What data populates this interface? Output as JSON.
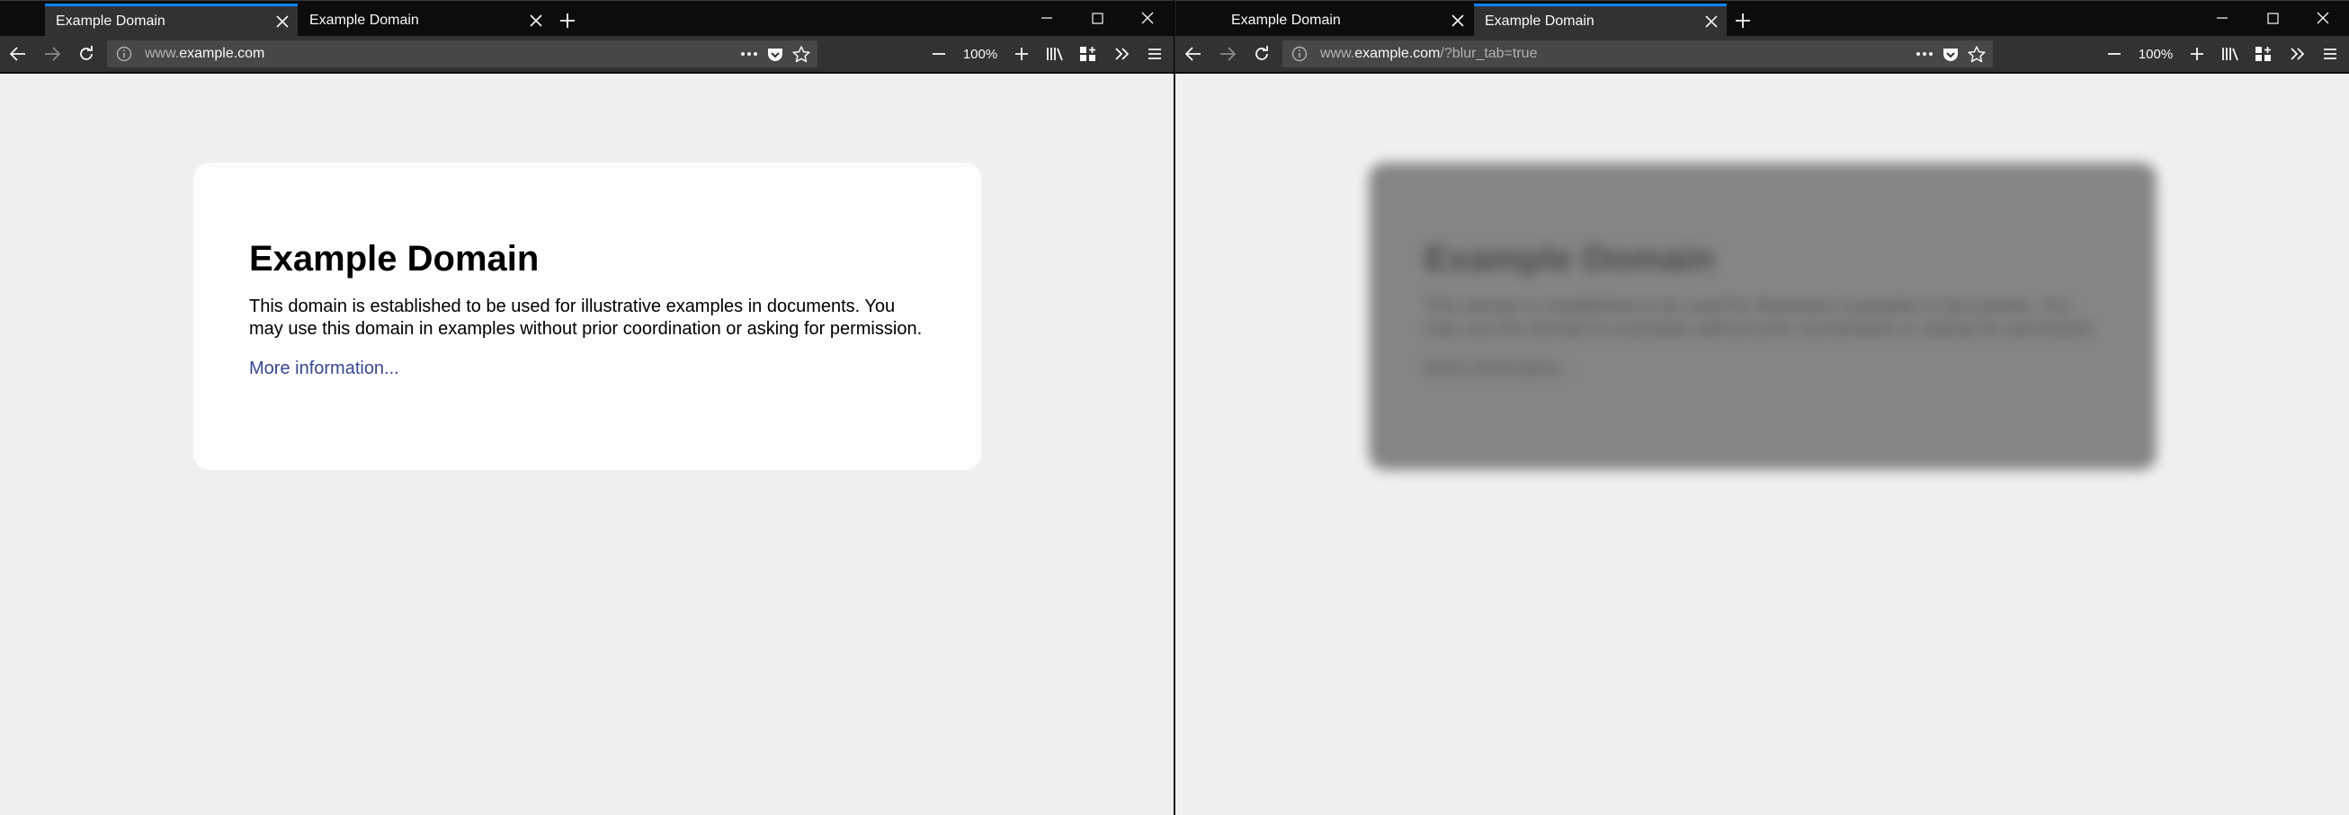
{
  "colors": {
    "chrome_dark": "#0c0c0d",
    "toolbar": "#323234",
    "urlbar": "#474749",
    "accent_tab": "#0a84ff",
    "page_bg": "#f0f0f2",
    "card_bg": "#fdfdff",
    "link": "#38488f"
  },
  "left": {
    "tabs": [
      {
        "title": "Example Domain",
        "active": true
      },
      {
        "title": "Example Domain",
        "active": false
      }
    ],
    "url": {
      "prefix": "www.",
      "domain": "example.com",
      "suffix": ""
    },
    "zoom": "100%",
    "page": {
      "heading": "Example Domain",
      "body": "This domain is established to be used for illustrative examples in documents. You may use this domain in examples without prior coordination or asking for permission.",
      "link": "More information..."
    }
  },
  "right": {
    "tabs": [
      {
        "title": "Example Domain",
        "active": false
      },
      {
        "title": "Example Domain",
        "active": true
      }
    ],
    "url": {
      "prefix": "www.",
      "domain": "example.com",
      "suffix": "/?blur_tab=true"
    },
    "zoom": "100%",
    "page": {
      "heading": "Example Domain",
      "body": "This domain is established to be used for illustrative examples in documents. You may use this domain in examples without prior coordination or asking for permission.",
      "link": "More information...",
      "blurred": true
    }
  },
  "icons": [
    "close-icon",
    "plus-icon",
    "minimize-icon",
    "maximize-icon",
    "back-arrow-icon",
    "forward-arrow-icon",
    "reload-icon",
    "info-icon",
    "more-dots-icon",
    "pocket-icon",
    "star-icon",
    "zoom-out-icon",
    "zoom-in-icon",
    "library-icon",
    "sidebar-icon",
    "overflow-chevron-icon",
    "hamburger-menu-icon"
  ]
}
